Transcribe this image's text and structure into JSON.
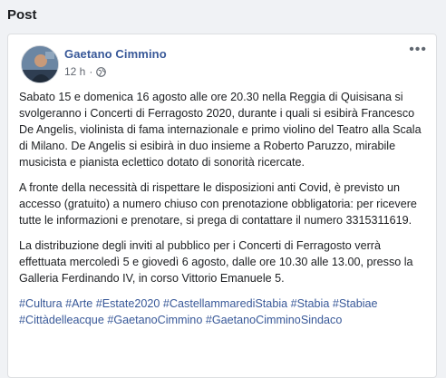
{
  "page": {
    "section_title": "Post"
  },
  "post": {
    "author": "Gaetano Cimmino",
    "time": "12 h",
    "separator": "·",
    "more_label": "•••",
    "paragraphs": [
      "Sabato 15 e domenica 16 agosto alle ore 20.30 nella Reggia di Quisisana si svolgeranno i Concerti di Ferragosto 2020, durante i quali si esibirà Francesco De Angelis, violinista di fama internazionale e primo violino del Teatro alla Scala di Milano. De Angelis si esibirà in duo insieme a Roberto Paruzzo, mirabile musicista e pianista eclettico dotato di sonorità ricercate.",
      "A fronte della necessità di rispettare le disposizioni anti Covid, è previsto un accesso (gratuito) a numero chiuso con prenotazione obbligatoria: per ricevere tutte le informazioni e prenotare, si prega di contattare il numero 3315311619.",
      "La distribuzione degli inviti al pubblico per i Concerti di Ferragosto verrà effettuata mercoledì 5 e giovedì 6 agosto, dalle ore 10.30 alle 13.00, presso la Galleria Ferdinando IV, in corso Vittorio Emanuele 5."
    ],
    "hashtags": "#Cultura #Arte #Estate2020 #CastellammarediStabia #Stabia #Stabiae #Cittàdelleacque #GaetanoCimmino #GaetanoCimminoSindaco"
  },
  "colors": {
    "link": "#385898",
    "text": "#1c1e21",
    "muted": "#616770"
  },
  "icons": {
    "privacy": "globe-icon",
    "menu": "more-options-icon"
  }
}
